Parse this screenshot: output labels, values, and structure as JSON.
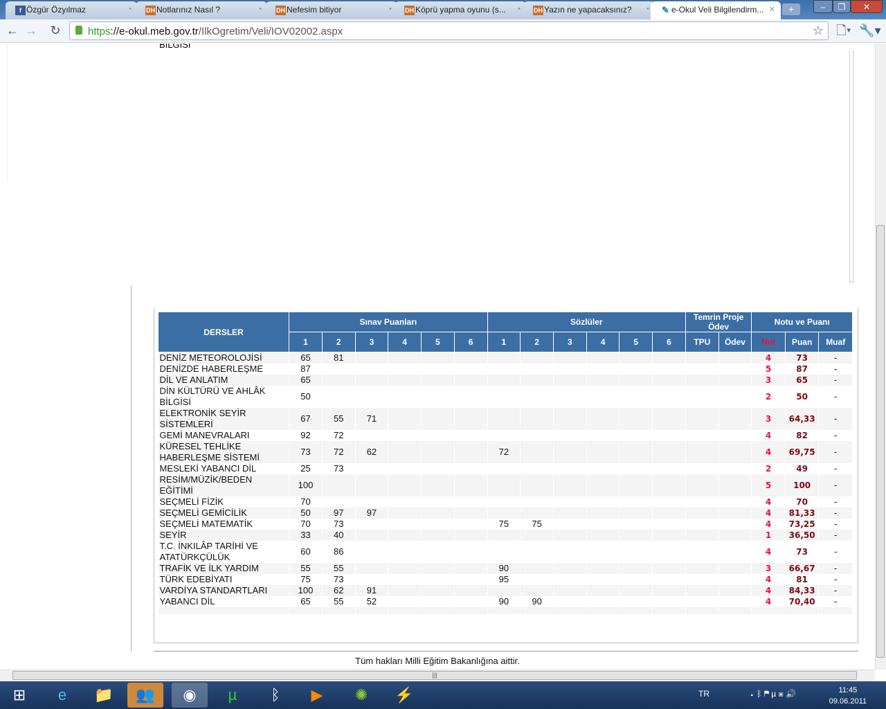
{
  "browser": {
    "tabs": [
      {
        "label": "Özgür Özyılmaz",
        "icon": "facebook-icon"
      },
      {
        "label": "Notlarınız Nasıl ?",
        "icon": "dh-icon"
      },
      {
        "label": "Nefesim bitiyor",
        "icon": "dh-icon"
      },
      {
        "label": "Köprü yapma oyunu (s...",
        "icon": "dh-icon"
      },
      {
        "label": "Yazın ne yapacaksınız?",
        "icon": "dh-icon"
      },
      {
        "label": "e-Okul Veli Bilgilendirm...",
        "icon": "eokul-icon",
        "active": true
      }
    ],
    "url_scheme": "https",
    "url_domain": "://e-okul.meb.gov.tr",
    "url_path": "/IlkOgretim/Veli/IOV02002.aspx"
  },
  "page": {
    "top_cut_text": "BİLGİSİ",
    "headers": {
      "dersler": "DERSLER",
      "sinav": "Sınav Puanları",
      "sozlu": "Sözlüler",
      "temrin": "Temrin Proje Ödev",
      "notu": "Notu ve Puanı",
      "nums": [
        "1",
        "2",
        "3",
        "4",
        "5",
        "6"
      ],
      "tpu": "TPU",
      "odev": "Ödev",
      "not": "Not",
      "puan": "Puan",
      "muaf": "Muaf"
    },
    "rows": [
      {
        "ders": "DENİZ METEOROLOJİSİ",
        "sinav": [
          "65",
          "81"
        ],
        "sozlu": [],
        "not": "4",
        "puan": "73",
        "muaf": "-"
      },
      {
        "ders": "DENİZDE HABERLEŞME",
        "sinav": [
          "87"
        ],
        "sozlu": [],
        "not": "5",
        "puan": "87",
        "muaf": "-"
      },
      {
        "ders": "DİL VE ANLATIM",
        "sinav": [
          "65"
        ],
        "sozlu": [],
        "not": "3",
        "puan": "65",
        "muaf": "-"
      },
      {
        "ders": "DİN KÜLTÜRÜ VE AHLÂK BİLGİSİ",
        "sinav": [
          "50"
        ],
        "sozlu": [],
        "not": "2",
        "puan": "50",
        "muaf": "-"
      },
      {
        "ders": "ELEKTRONİK SEYİR SİSTEMLERİ",
        "sinav": [
          "67",
          "55",
          "71"
        ],
        "sozlu": [],
        "not": "3",
        "puan": "64,33",
        "muaf": "-"
      },
      {
        "ders": "GEMİ MANEVRALARI",
        "sinav": [
          "92",
          "72"
        ],
        "sozlu": [],
        "not": "4",
        "puan": "82",
        "muaf": "-"
      },
      {
        "ders": "KÜRESEL TEHLİKE HABERLEŞME SİSTEMİ",
        "sinav": [
          "73",
          "72",
          "62"
        ],
        "sozlu": [
          "72"
        ],
        "not": "4",
        "puan": "69,75",
        "muaf": "-"
      },
      {
        "ders": "MESLEKİ YABANCI DİL",
        "sinav": [
          "25",
          "73"
        ],
        "sozlu": [],
        "not": "2",
        "puan": "49",
        "muaf": "-"
      },
      {
        "ders": "RESİM/MÜZİK/BEDEN EĞİTİMİ",
        "sinav": [
          "100"
        ],
        "sozlu": [],
        "not": "5",
        "puan": "100",
        "muaf": "-"
      },
      {
        "ders": "SEÇMELİ FİZİK",
        "sinav": [
          "70"
        ],
        "sozlu": [],
        "not": "4",
        "puan": "70",
        "muaf": "-"
      },
      {
        "ders": "SEÇMELİ GEMİCİLİK",
        "sinav": [
          "50",
          "97",
          "97"
        ],
        "sozlu": [],
        "not": "4",
        "puan": "81,33",
        "muaf": "-"
      },
      {
        "ders": "SEÇMELİ MATEMATİK",
        "sinav": [
          "70",
          "73"
        ],
        "sozlu": [
          "75",
          "75"
        ],
        "not": "4",
        "puan": "73,25",
        "muaf": "-"
      },
      {
        "ders": "SEYİR",
        "sinav": [
          "33",
          "40"
        ],
        "sozlu": [],
        "not": "1",
        "puan": "36,50",
        "muaf": "-"
      },
      {
        "ders": "T.C. İNKILÂP TARİHİ VE ATATÜRKÇÜLÜK",
        "sinav": [
          "60",
          "86"
        ],
        "sozlu": [],
        "not": "4",
        "puan": "73",
        "muaf": "-"
      },
      {
        "ders": "TRAFİK VE İLK YARDIM",
        "sinav": [
          "55",
          "55"
        ],
        "sozlu": [
          "90"
        ],
        "not": "3",
        "puan": "66,67",
        "muaf": "-"
      },
      {
        "ders": "TÜRK EDEBİYATI",
        "sinav": [
          "75",
          "73"
        ],
        "sozlu": [
          "95"
        ],
        "not": "4",
        "puan": "81",
        "muaf": "-"
      },
      {
        "ders": "VARDİYA STANDARTLARI",
        "sinav": [
          "100",
          "62",
          "91"
        ],
        "sozlu": [],
        "not": "4",
        "puan": "84,33",
        "muaf": "-"
      },
      {
        "ders": "YABANCI DİL",
        "sinav": [
          "65",
          "55",
          "52"
        ],
        "sozlu": [
          "90",
          "90"
        ],
        "not": "4",
        "puan": "70,40",
        "muaf": "-"
      }
    ],
    "footer": "Tüm hakları Milli Eğitim Bakanlığına aittir."
  },
  "taskbar": {
    "lang": "TR",
    "time": "11:45",
    "date": "09.06.2011"
  },
  "colors": {
    "header": "#3b6ea5",
    "not": "#e8123a",
    "puan": "#7a0a10"
  }
}
